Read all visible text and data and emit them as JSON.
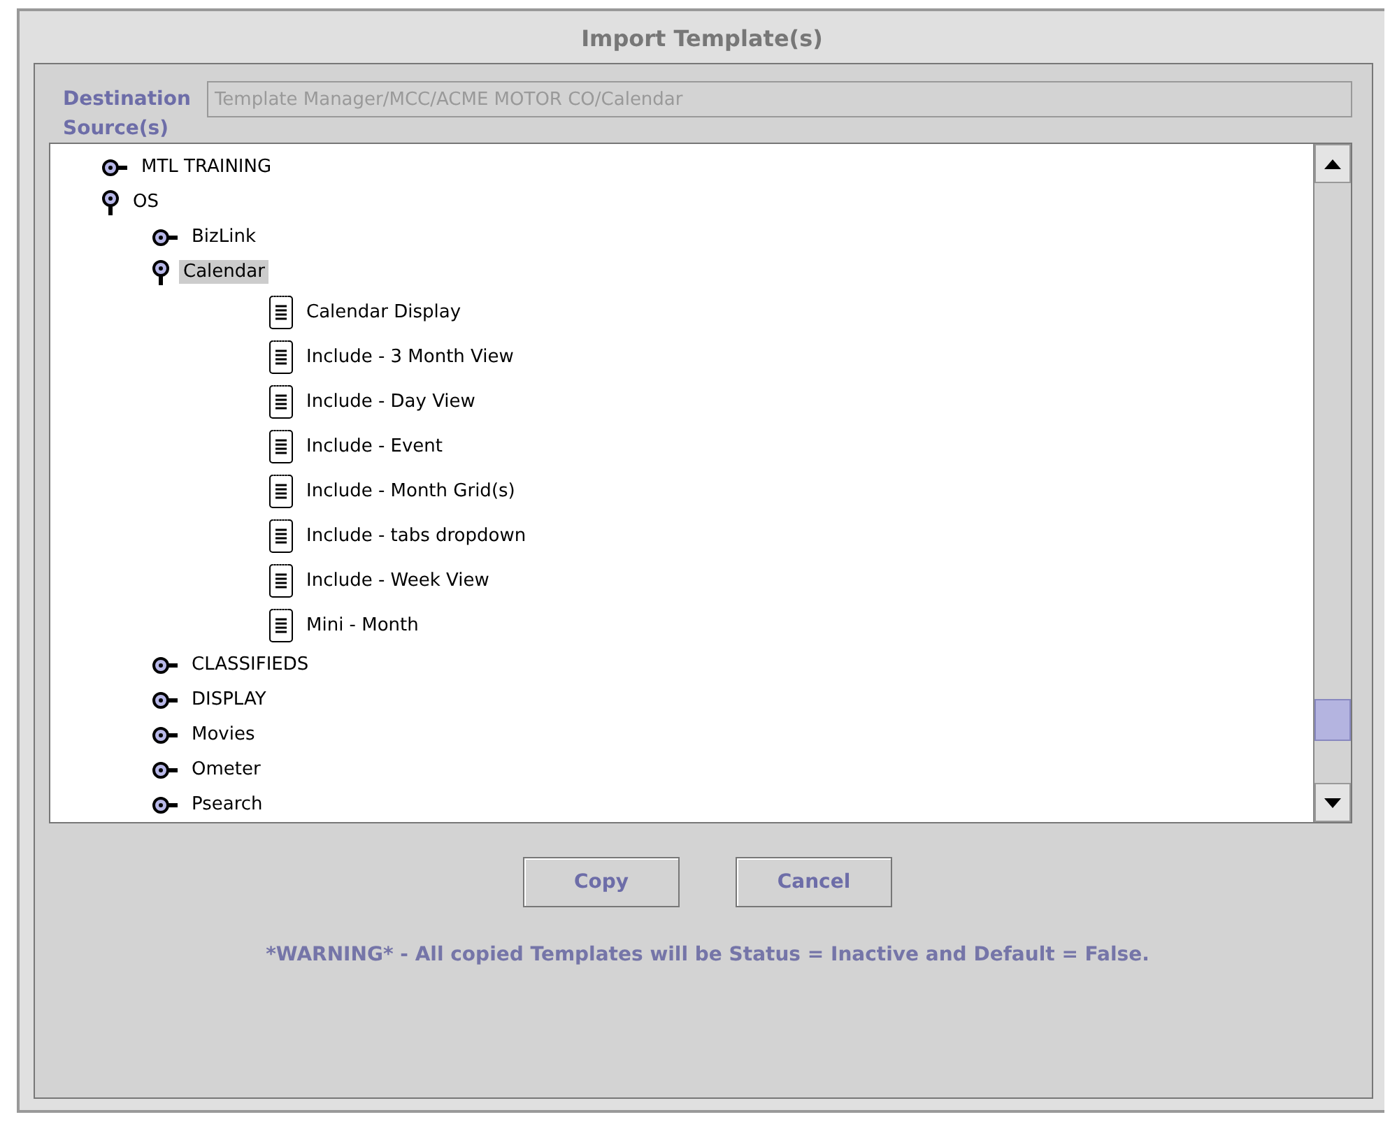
{
  "window": {
    "title": "Import Template(s)"
  },
  "destination": {
    "label": "Destination",
    "value": "Template Manager/MCC/ACME MOTOR CO/Calendar",
    "disabled": true
  },
  "sources": {
    "label": "Source(s)",
    "tree": [
      {
        "kind": "folder",
        "label": "MTL TRAINING",
        "expanded": false,
        "selected": false
      },
      {
        "kind": "folder",
        "label": "OS",
        "expanded": true,
        "selected": false,
        "children": [
          {
            "kind": "folder",
            "label": "BizLink",
            "expanded": false,
            "selected": false
          },
          {
            "kind": "folder",
            "label": "Calendar",
            "expanded": true,
            "selected": true,
            "children": [
              {
                "kind": "document",
                "label": "Calendar Display",
                "selected": false
              },
              {
                "kind": "document",
                "label": "Include - 3 Month View",
                "selected": false
              },
              {
                "kind": "document",
                "label": "Include - Day View",
                "selected": false
              },
              {
                "kind": "document",
                "label": "Include - Event",
                "selected": false
              },
              {
                "kind": "document",
                "label": "Include - Month Grid(s)",
                "selected": false
              },
              {
                "kind": "document",
                "label": "Include - tabs dropdown",
                "selected": false
              },
              {
                "kind": "document",
                "label": "Include - Week View",
                "selected": false
              },
              {
                "kind": "document",
                "label": "Mini - Month",
                "selected": false
              }
            ]
          },
          {
            "kind": "folder",
            "label": "CLASSIFIEDS",
            "expanded": false,
            "selected": false
          },
          {
            "kind": "folder",
            "label": "DISPLAY",
            "expanded": false,
            "selected": false
          },
          {
            "kind": "folder",
            "label": "Movies",
            "expanded": false,
            "selected": false
          },
          {
            "kind": "folder",
            "label": "Ometer",
            "expanded": false,
            "selected": false
          },
          {
            "kind": "folder",
            "label": "Psearch",
            "expanded": false,
            "selected": false
          }
        ]
      }
    ]
  },
  "buttons": [
    "Copy",
    "Cancel"
  ],
  "warning": "*WARNING* - All copied Templates will be Status = Inactive and Default = False."
}
